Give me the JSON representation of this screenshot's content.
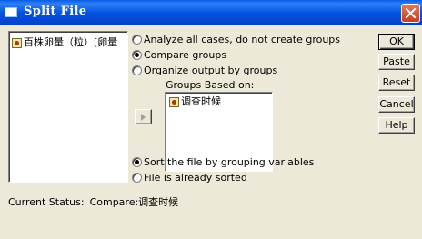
{
  "window": {
    "title": "Split File"
  },
  "source_list": {
    "items": [
      {
        "label": "百株卵量（粒）[卵量"
      }
    ]
  },
  "options": {
    "analyze_all": "Analyze all cases, do not create groups",
    "compare": "Compare groups",
    "organize": "Organize output by groups",
    "selected": "compare"
  },
  "groups_based_on": {
    "label": "Groups Based on:",
    "items": [
      {
        "label": "调查时候"
      }
    ]
  },
  "sort_options": {
    "sort": "Sort the file by grouping variables",
    "sorted": "File is already sorted",
    "selected": "sort"
  },
  "buttons": {
    "ok": "OK",
    "paste": "Paste",
    "reset": "Reset",
    "cancel": "Cancel",
    "help": "Help"
  },
  "status": {
    "label": "Current Status:",
    "value": "Compare:调查时候"
  },
  "colors": {
    "titlebar": "#0A5CE8",
    "dialog_bg": "#ECE9D8",
    "close": "#D6502B"
  },
  "icons": {
    "variable": "numeric-variable-icon",
    "move": "right-arrow-icon",
    "close": "close-icon"
  }
}
